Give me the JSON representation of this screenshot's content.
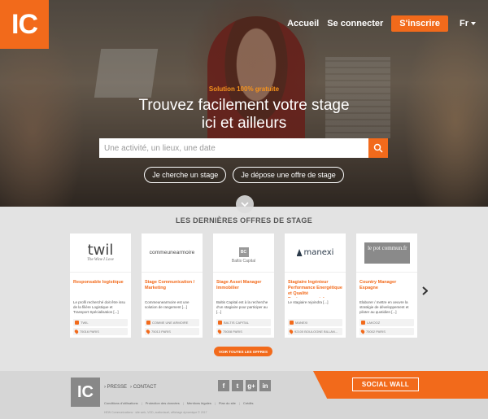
{
  "brand": {
    "logo_text": "IC",
    "accent": "#f26a1b"
  },
  "nav": {
    "home": "Accueil",
    "login": "Se connecter",
    "signup": "S'inscrire",
    "language": "Fr"
  },
  "hero": {
    "tagline": "Solution 100% gratuite",
    "title_line1": "Trouvez  facilement votre stage",
    "title_line2": "ici et ailleurs",
    "search_placeholder": "Une activité, un lieux, une date",
    "search_icon": "search-icon",
    "btn_seek": "Je cherche un stage",
    "btn_post": "Je dépose une offre de stage"
  },
  "offers": {
    "title": "LES DERNIÈRES OFFRES DE STAGE",
    "all_button": "VOIR TOUTES LES OFFRES",
    "cards": [
      {
        "logo": "twil",
        "logo_sub": "The Wine I Love",
        "title": "Responsable logistique",
        "desc": "Le profil recherché doit être issu de la filière Logistique et Transport Spécialisation [...]",
        "company": "TWIL",
        "location": "75016 PARIS"
      },
      {
        "logo": "commeunearmoire",
        "title": "Stage Communication / Marketing",
        "desc": "Commeunearmoire est une solution de rangement [...]",
        "company": "COMME UNE ARMOIRE",
        "location": "75013 PARIS"
      },
      {
        "logo": "BC",
        "logo_sub": "Baltis Capital",
        "title": "Stage Asset Manager Immobilier",
        "desc": "Baltis Capital est à la recherche d'un stagiaire pour participer au [...]",
        "company": "BALTIS CAPITAL",
        "location": "75008 PARIS"
      },
      {
        "logo": "manexi",
        "title": "Stagiaire Ingénieur Performance Energétique et Qualité Environnementale",
        "desc": "Le stagiaire rejoindra [...]",
        "company": "MANEXI",
        "location": "92100 BOULOGNE BILLAN..."
      },
      {
        "logo": "le pot commun.fr",
        "title": "Country Manager Espagne",
        "desc": "Elaborer / mettre en oeuvre la stratégie de développement et piloter au quotidien [...]",
        "company": "LAKOOZ",
        "location": "75002 PARIS"
      }
    ]
  },
  "footer": {
    "logo_text": "IC",
    "link_press": "PRESSE",
    "link_contact": "CONTACT",
    "social": [
      "f",
      "t",
      "g+",
      "in"
    ],
    "social_wall": "SOCIAL WALL",
    "legal": [
      "Conditions d'utilisations",
      "Protection des données",
      "Mentions légales",
      "Plan du site",
      "Crédits"
    ],
    "copyright": "HEW Communications · site web, VOD, audiovisuel, affichage dynamique © 2017"
  }
}
